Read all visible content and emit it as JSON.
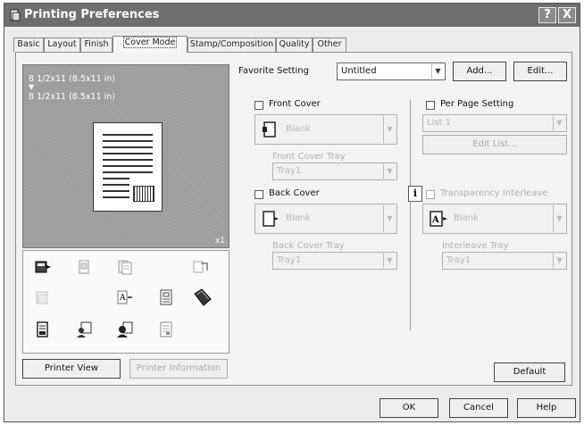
{
  "window": {
    "title": "Printing Preferences",
    "help_button": "?",
    "close_button": "X"
  },
  "tabs": [
    "Basic",
    "Layout",
    "Finish",
    "Cover Mode",
    "Stamp/Composition",
    "Quality",
    "Other"
  ],
  "active_tab": "Cover Mode",
  "preview": {
    "original_size": "8 1/2x11 (8.5x11 in)",
    "arrow": "▼",
    "output_size": "8 1/2x11 (8.5x11 in)",
    "copies": "x1"
  },
  "bottom_left_buttons": {
    "printer_view": "Printer View",
    "printer_information": "Printer Information"
  },
  "favorite": {
    "label": "Favorite Setting",
    "value": "Untitled",
    "add": "Add...",
    "edit": "Edit..."
  },
  "front_cover": {
    "label": "Front Cover",
    "paper": "Blank",
    "tray_label": "Front Cover Tray",
    "tray": "Tray1"
  },
  "back_cover": {
    "label": "Back Cover",
    "paper": "Blank",
    "tray_label": "Back Cover Tray",
    "tray": "Tray1"
  },
  "per_page": {
    "label": "Per Page Setting",
    "list": "List 1",
    "edit_list": "Edit List..."
  },
  "transparency": {
    "label": "Transparency Interleave",
    "paper": "Blank",
    "tray_label": "Interleave Tray",
    "tray": "Tray1"
  },
  "default_button": "Default",
  "footer": {
    "ok": "OK",
    "cancel": "Cancel",
    "help": "Help"
  },
  "colors": {
    "titlebar": "#6e6e6e",
    "preview_bg": "#9c9c9c",
    "dialog_bg": "#ececec"
  }
}
